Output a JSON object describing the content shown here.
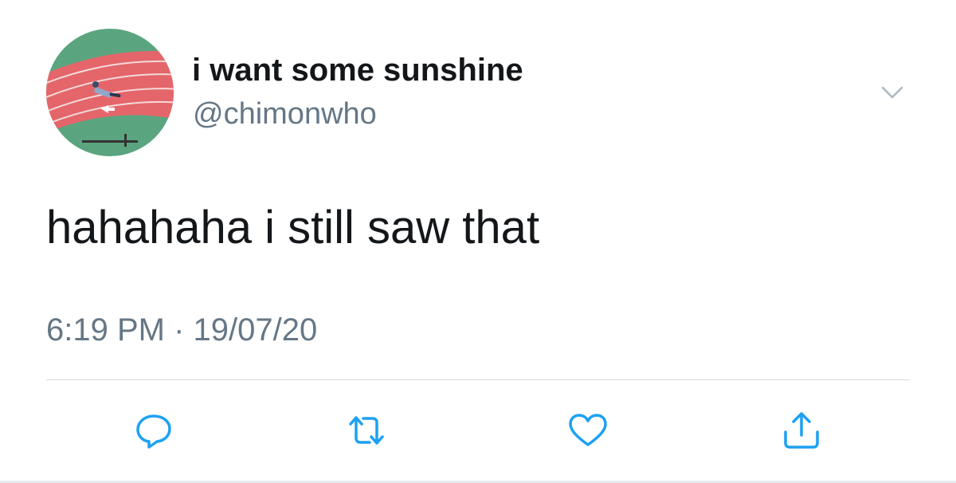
{
  "tweet": {
    "display_name": "i want some sunshine",
    "handle": "@chimonwho",
    "text": "hahahaha i still saw that",
    "timestamp": "6:19 PM · 19/07/20"
  },
  "icons": {
    "menu": "chevron-down-icon",
    "reply": "reply-icon",
    "retweet": "retweet-icon",
    "like": "heart-icon",
    "share": "share-icon"
  },
  "colors": {
    "text": "#14171a",
    "secondary": "#657786",
    "icon": "#1da1f2",
    "divider": "#d6dce1"
  }
}
